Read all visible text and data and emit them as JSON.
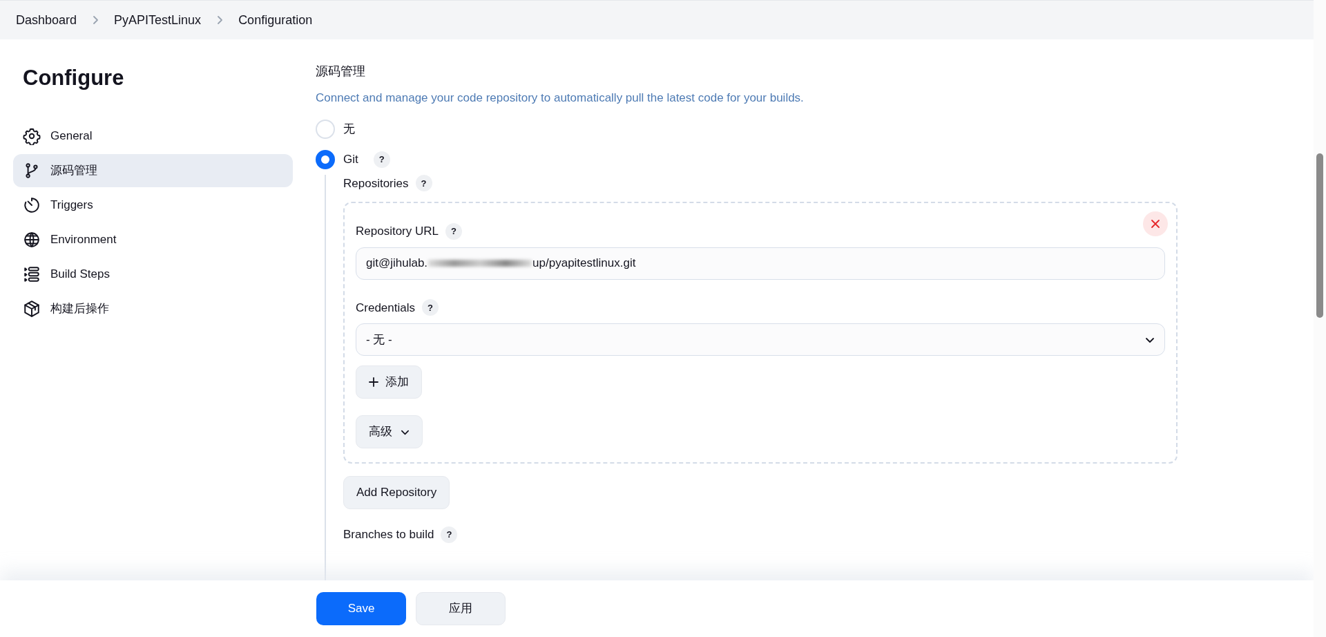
{
  "breadcrumbs": [
    {
      "label": "Dashboard"
    },
    {
      "label": "PyAPITestLinux"
    },
    {
      "label": "Configuration"
    }
  ],
  "page_title": "Configure",
  "sidebar": {
    "items": [
      {
        "label": "General",
        "selected": false
      },
      {
        "label": "源码管理",
        "selected": true
      },
      {
        "label": "Triggers",
        "selected": false
      },
      {
        "label": "Environment",
        "selected": false
      },
      {
        "label": "Build Steps",
        "selected": false
      },
      {
        "label": "构建后操作",
        "selected": false
      }
    ]
  },
  "section": {
    "title": "源码管理",
    "description": "Connect and manage your code repository to automatically pull the latest code for your builds.",
    "options": [
      {
        "label": "无",
        "selected": false
      },
      {
        "label": "Git",
        "selected": true,
        "help": "?"
      }
    ],
    "git": {
      "repositories_label": "Repositories",
      "repositories_help": "?",
      "repository": {
        "url_label": "Repository URL",
        "url_help": "?",
        "url_value_start": "git@jihulab.",
        "url_value_end": "up/pyapitestlinux.git",
        "credentials_label": "Credentials",
        "credentials_help": "?",
        "credentials_value": "- 无 -",
        "add_button": "添加",
        "advanced_button": "高级"
      },
      "add_repository_button": "Add Repository",
      "branches_label": "Branches to build",
      "branches_help": "?"
    }
  },
  "footer": {
    "buttons": [
      {
        "label": "Save",
        "kind": "primary"
      },
      {
        "label": "应用",
        "kind": "secondary"
      }
    ]
  }
}
